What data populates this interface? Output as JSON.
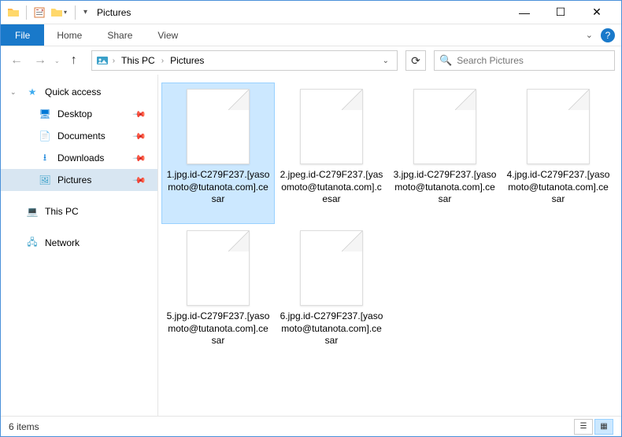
{
  "titlebar": {
    "title": "Pictures"
  },
  "window_controls": {
    "minimize": "—",
    "maximize": "☐",
    "close": "✕"
  },
  "ribbon": {
    "file": "File",
    "tabs": [
      "Home",
      "Share",
      "View"
    ],
    "expand_glyph": "⌄",
    "help_glyph": "?"
  },
  "nav": {
    "back_glyph": "←",
    "forward_glyph": "→",
    "recent_glyph": "⌄",
    "up_glyph": "↑",
    "breadcrumb": [
      "This PC",
      "Pictures"
    ],
    "breadcrumb_sep": "›",
    "dropdown_glyph": "⌄",
    "refresh_glyph": "⟳"
  },
  "search": {
    "placeholder": "Search Pictures",
    "icon_glyph": "🔍"
  },
  "sidebar": {
    "quick_access": {
      "label": "Quick access",
      "star": "★",
      "caret": "⌄"
    },
    "items": [
      {
        "label": "Desktop",
        "icon": "🖥",
        "pinned": true,
        "color": "#0078d7"
      },
      {
        "label": "Documents",
        "icon": "📄",
        "pinned": true,
        "color": "#555"
      },
      {
        "label": "Downloads",
        "icon": "⭳",
        "pinned": true,
        "color": "#0078d7"
      },
      {
        "label": "Pictures",
        "icon": "🖼",
        "pinned": true,
        "color": "#3aa0c9",
        "selected": true
      }
    ],
    "this_pc": {
      "label": "This PC",
      "icon": "💻"
    },
    "network": {
      "label": "Network",
      "icon": "🖧"
    },
    "pin_glyph": "📌"
  },
  "files": [
    {
      "name": "1.jpg.id-C279F237.[yasomoto@tutanota.com].cesar",
      "selected": true
    },
    {
      "name": "2.jpeg.id-C279F237.[yasomoto@tutanota.com].cesar",
      "selected": false
    },
    {
      "name": "3.jpg.id-C279F237.[yasomoto@tutanota.com].cesar",
      "selected": false
    },
    {
      "name": "4.jpg.id-C279F237.[yasomoto@tutanota.com].cesar",
      "selected": false
    },
    {
      "name": "5.jpg.id-C279F237.[yasomoto@tutanota.com].cesar",
      "selected": false
    },
    {
      "name": "6.jpg.id-C279F237.[yasomoto@tutanota.com].cesar",
      "selected": false
    }
  ],
  "statusbar": {
    "count_label": "6 items"
  },
  "view_buttons": {
    "details_glyph": "☰",
    "icons_glyph": "▦"
  }
}
